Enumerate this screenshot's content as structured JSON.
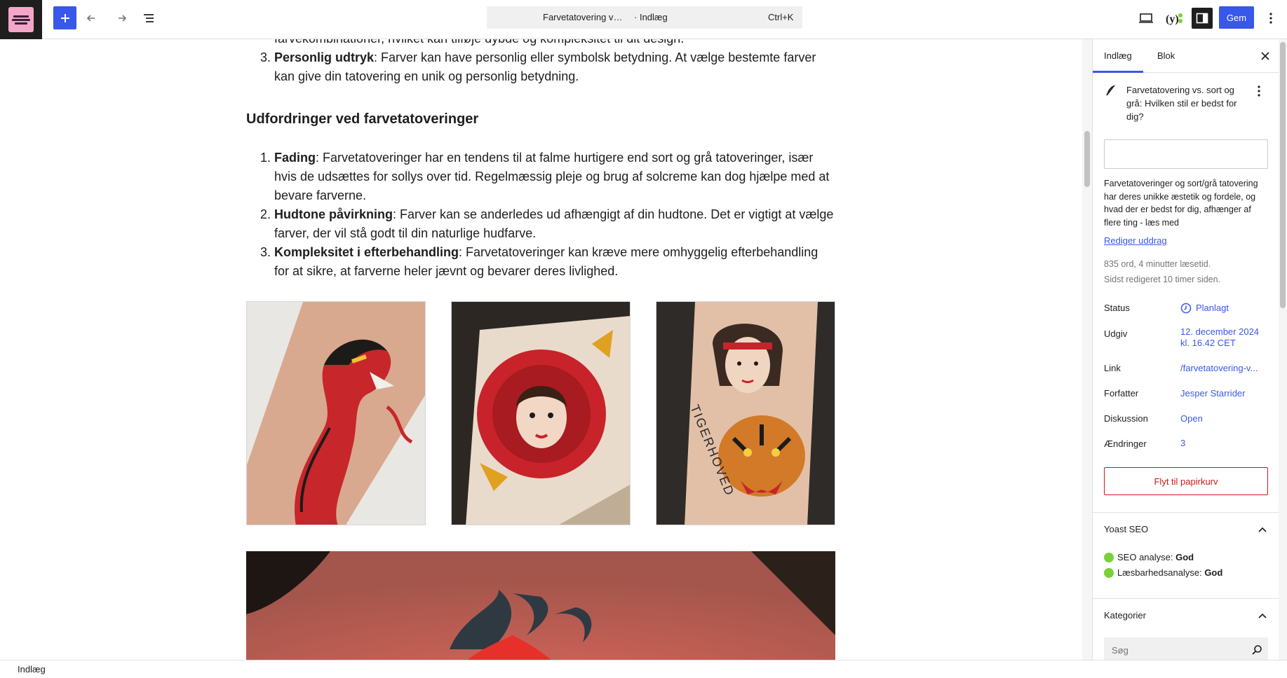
{
  "header": {
    "document_title": "Farvetatovering vs. sort og grå: Hvilken stil er bedst for dig?",
    "document_type": "Indlæg",
    "shortcut": "Ctrl+K",
    "save_label": "Gem",
    "icons": [
      "plus-icon",
      "undo-icon",
      "redo-icon",
      "list-view-icon",
      "preview-desktop-icon",
      "yoast-icon",
      "sidebar-toggle-icon",
      "kebab-menu-icon"
    ]
  },
  "content": {
    "list_intro": [
      {
        "num": "3.",
        "bold": "Personlig udtryk",
        "text": ": Farver kan have personlig eller symbolsk betydning. At vælge bestemte farver kan give din tatovering en unik og personlig betydning."
      }
    ],
    "prev_line": "farvekombinationer, hvilket kan tilføje dybde og kompleksitet til dit design.",
    "heading": "Udfordringer ved farvetatoveringer",
    "challenges": [
      {
        "bold": "Fading",
        "text": ": Farvetatoveringer har en tendens til at falme hurtigere end sort og grå tatoveringer, især hvis de udsættes for sollys over tid. Regelmæssig pleje og brug af solcreme kan dog hjælpe med at bevare farverne."
      },
      {
        "bold": "Hudtone påvirkning",
        "text": ": Farver kan se anderledes ud afhængigt af din hudtone. Det er vigtigt at vælge farver, der vil stå godt til din naturlige hudfarve."
      },
      {
        "bold": "Kompleksitet i efterbehandling",
        "text": ": Farvetatoveringer kan kræve mere omhyggelig efterbehandling for at sikre, at farverne heler jævnt og bevarer deres livlighed."
      }
    ],
    "tattoo_text": "TIGERHOVED"
  },
  "sidebar": {
    "tabs": [
      "Indlæg",
      "Blok"
    ],
    "post_title": "Farvetatovering vs. sort og grå: Hvilken stil er bedst for dig?",
    "excerpt": "Farvetatoveringer og sort/grå tatovering har deres unikke æstetik og fordele, og hvad der er bedst for dig, afhænger af flere ting - læs med",
    "edit_excerpt": "Rediger uddrag",
    "stats": "835 ord, 4 minutter læsetid.",
    "last_edited": "Sidst redigeret 10 timer siden.",
    "rows": {
      "status_label": "Status",
      "status_value": "Planlagt",
      "publish_label": "Udgiv",
      "publish_value": "12. december 2024 kl. 16.42 CET",
      "link_label": "Link",
      "link_value": "/farvetatovering-v...",
      "author_label": "Forfatter",
      "author_value": "Jesper Starrider",
      "discussion_label": "Diskussion",
      "discussion_value": "Open",
      "revisions_label": "Ændringer",
      "revisions_value": "3"
    },
    "trash_label": "Flyt til papirkurv",
    "yoast": {
      "title": "Yoast SEO",
      "seo_label": "SEO analyse: ",
      "seo_value": "God",
      "read_label": "Læsbarhedsanalyse: ",
      "read_value": "God"
    },
    "categories": {
      "title": "Kategorier",
      "search_placeholder": "Søg"
    }
  },
  "footer": {
    "breadcrumb": "Indlæg"
  },
  "colors": {
    "accent": "#3858e9",
    "danger": "#cc1818",
    "good": "#7ad03a"
  }
}
